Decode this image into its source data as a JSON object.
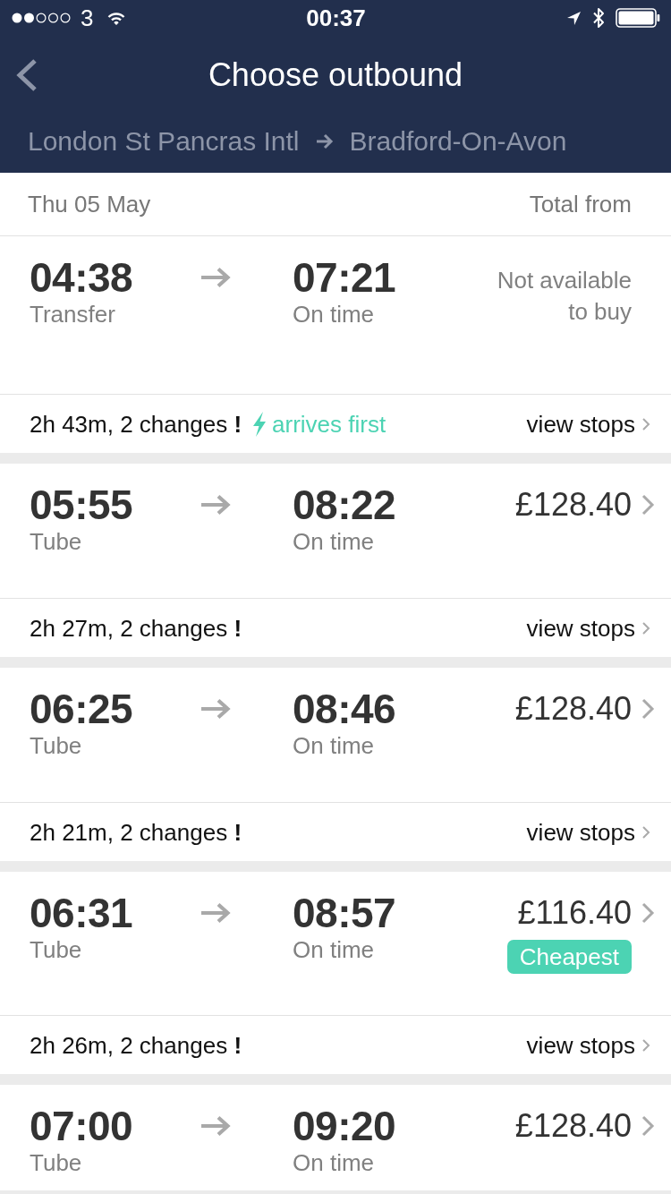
{
  "status_bar": {
    "carrier": "3",
    "time": "00:37"
  },
  "header": {
    "title": "Choose outbound",
    "origin": "London St Pancras Intl",
    "destination": "Bradford-On-Avon"
  },
  "list_header": {
    "date": "Thu 05 May",
    "price_heading": "Total from"
  },
  "journeys": [
    {
      "depart": "04:38",
      "depart_note": "Transfer",
      "arrive": "07:21",
      "arrive_note": "On time",
      "price": {
        "kind": "unavailable",
        "text": "Not available to buy"
      },
      "summary": {
        "text": "2h 43m, 2 changes **!**",
        "highlight": "arrives first",
        "link": "view stops"
      }
    },
    {
      "depart": "05:55",
      "depart_note": "Tube",
      "arrive": "08:22",
      "arrive_note": "On time",
      "price": {
        "kind": "fare",
        "text": "£128.40"
      },
      "summary": {
        "text": "2h 27m, 2 changes **!**",
        "link": "view stops"
      }
    },
    {
      "depart": "06:25",
      "depart_note": "Tube",
      "arrive": "08:46",
      "arrive_note": "On time",
      "price": {
        "kind": "fare",
        "text": "£128.40"
      },
      "summary": {
        "text": "2h 21m, 2 changes **!**",
        "link": "view stops"
      }
    },
    {
      "depart": "06:31",
      "depart_note": "Tube",
      "arrive": "08:57",
      "arrive_note": "On time",
      "price": {
        "kind": "fare",
        "text": "£116.40",
        "badge": "Cheapest"
      },
      "summary": {
        "text": "2h 26m, 2 changes **!**",
        "link": "view stops"
      }
    },
    {
      "depart": "07:00",
      "depart_note": "Tube",
      "arrive": "09:20",
      "arrive_note": "On time",
      "price": {
        "kind": "fare",
        "text": "£128.40"
      }
    }
  ]
}
